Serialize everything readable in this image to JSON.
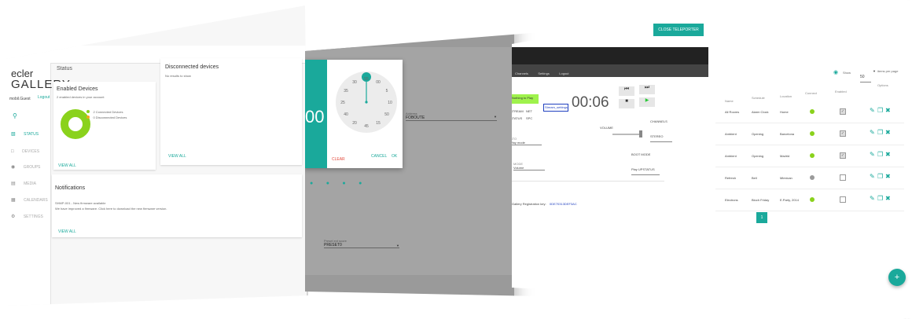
{
  "panel1": {
    "brand_top": "ecler",
    "brand_bottom": "GALLERY",
    "user": "mobil.Guest",
    "logout": "Logout",
    "status_title": "Status",
    "nav": [
      {
        "label": "STATUS",
        "icon": "status-icon"
      },
      {
        "label": "DEVICES",
        "icon": "devices-icon"
      },
      {
        "label": "GROUPS",
        "icon": "groups-icon"
      },
      {
        "label": "MEDIA",
        "icon": "media-icon"
      },
      {
        "label": "CALENDARS",
        "icon": "calendar-icon"
      },
      {
        "label": "SETTINGS",
        "icon": "gear-icon"
      }
    ],
    "enabled_title": "Enabled Devices",
    "enabled_sub": "2 enabled devices in your account",
    "legend_connected": "2 Connected Devices",
    "legend_disconnected": "0 Disconnected Devices",
    "view_all": "VIEW ALL",
    "disc_title": "Disconnected devices",
    "disc_sub": "No results to show",
    "notif_title": "Notifications",
    "notif_line1": "SHMP-001 - New firmware available",
    "notif_line2": "We have improved a firmware. Click here to download the new firmware version.",
    "colors": {
      "connected": "#8ad21c",
      "disconnected": "#f0a81c"
    },
    "chart_data": {
      "type": "pie",
      "categories": [
        "Connected Devices",
        "Disconnected Devices"
      ],
      "values": [
        2,
        0
      ]
    }
  },
  "panel2": {
    "time": "00",
    "clock_numbers": [
      "55",
      "00",
      "5",
      "10",
      "50",
      "15",
      "45",
      "20",
      "40",
      "25",
      "35",
      "30"
    ],
    "clear": "CLEAR",
    "cancel": "CANCEL",
    "ok": "OK",
    "field_label": "Address",
    "field_value": "FOBOUTE",
    "preset_label": "Preset ext score",
    "preset_value": "PRESET0"
  },
  "panel3": {
    "close_button": "CLOSE TELEPORTER",
    "menu": [
      "Channels",
      "Settings",
      "Logout"
    ],
    "status_value": "Nothing to Play",
    "info_labels": [
      "STREAM",
      "NET",
      "STATUS",
      "SPC"
    ],
    "input_text": "Stream_settings",
    "timer": "00:06",
    "volume_label": "VOLUME",
    "channels_label": "CHANNELS",
    "channels_value": "STEREO",
    "field1_label": "STO",
    "field1_value": "Play mode",
    "field2_label": "MODE",
    "field2_value": "Volume",
    "boot_label": "BOOT MODE",
    "boot_value": "Play UPSTATUS",
    "registration_text": "Gallery Registration key:",
    "registration_key": "0DE70313DEF3AC"
  },
  "panel4": {
    "show_label": "Show",
    "show_value": "50",
    "per_page": "items per page",
    "headers": [
      "Name",
      "Schedule",
      "Location",
      "Connect",
      "Enabled",
      "Options"
    ],
    "rows": [
      {
        "group": "",
        "name": "All Rooms",
        "schedule": "Alarm Clock",
        "location": "Home",
        "connected": true,
        "enabled": true
      },
      {
        "group": "",
        "name": "Ambient",
        "schedule": "Opening",
        "location": "Barcelona",
        "connected": true,
        "enabled": true
      },
      {
        "group": "",
        "name": "Ambient",
        "schedule": "Opening",
        "location": "Madrid",
        "connected": true,
        "enabled": true
      },
      {
        "group": "",
        "name": "Refresh",
        "schedule": "Bell",
        "location": "Mlexican",
        "connected": false,
        "enabled": false
      },
      {
        "group": "",
        "name": "Electrons",
        "schedule": "Bloch Friday",
        "location": "E.Party, 2014",
        "connected": true,
        "enabled": false
      }
    ],
    "page": "1",
    "fab": "+"
  }
}
